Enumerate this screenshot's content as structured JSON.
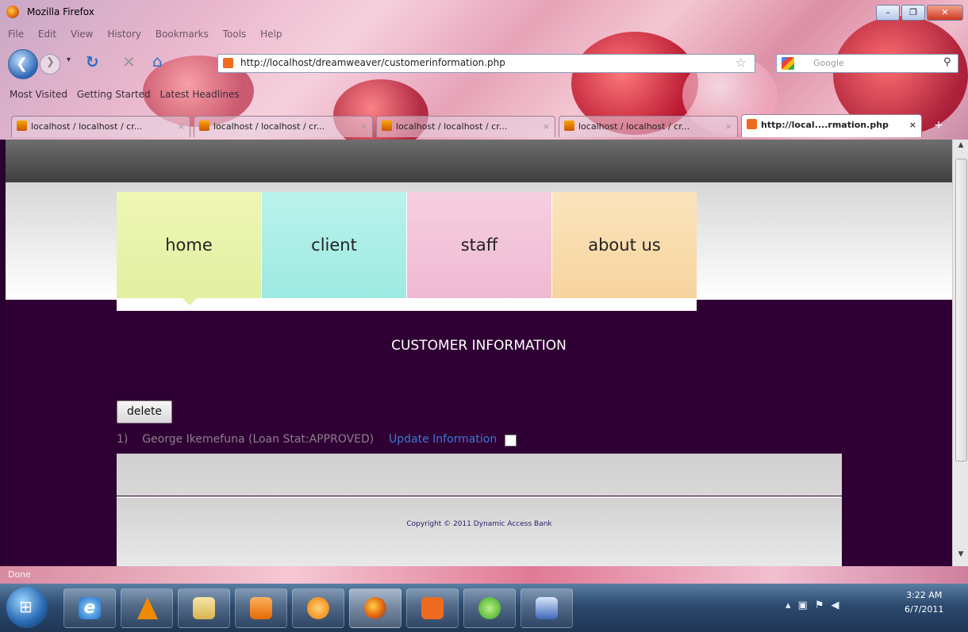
{
  "window": {
    "title": "Mozilla Firefox",
    "minimize": "–",
    "maximize": "❐",
    "close": "✕"
  },
  "menubar": [
    "File",
    "Edit",
    "View",
    "History",
    "Bookmarks",
    "Tools",
    "Help"
  ],
  "urlbar": {
    "url": "http://localhost/dreamweaver/customerinformation.php"
  },
  "searchbar": {
    "placeholder": "Google"
  },
  "bookmarks": [
    "Most Visited",
    "Getting Started",
    "Latest Headlines"
  ],
  "tabs": [
    {
      "label": "localhost / localhost / cr..."
    },
    {
      "label": "localhost / localhost / cr..."
    },
    {
      "label": "localhost / localhost / cr..."
    },
    {
      "label": "localhost / localhost / cr..."
    },
    {
      "label": "http://local....rmation.php"
    }
  ],
  "site": {
    "nav": [
      "home",
      "client",
      "staff",
      "about us"
    ],
    "title": "CUSTOMER INFORMATION",
    "delete_label": "delete",
    "record": {
      "index": "1)",
      "text": "George Ikemefuna (Loan Stat:APPROVED)",
      "link": "Update Information"
    },
    "copyright": "Copyright © 2011 Dynamic Access Bank"
  },
  "status": {
    "text": "Done"
  },
  "taskbar": {
    "time": "3:22 AM",
    "date": "6/7/2011"
  },
  "colors": {
    "page_bg": "#2f0033",
    "link": "#3f78d6"
  }
}
